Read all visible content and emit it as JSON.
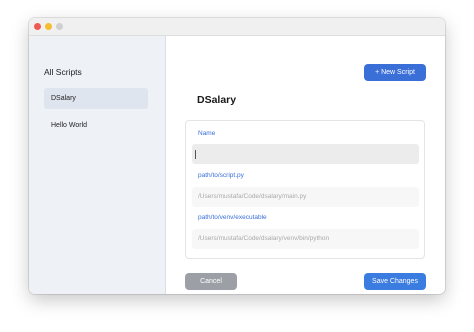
{
  "window": {
    "controls": [
      "close",
      "minimize",
      "maximize"
    ]
  },
  "sidebar": {
    "title": "All Scripts",
    "items": [
      {
        "label": "DSalary",
        "selected": true
      },
      {
        "label": "Hello World",
        "selected": false
      }
    ]
  },
  "header": {
    "new_script_label": "+ New Script"
  },
  "editor": {
    "title": "DSalary",
    "fields": {
      "name": {
        "label": "Name",
        "value": "",
        "placeholder": ""
      },
      "script_path": {
        "label": "path/to/script.py",
        "placeholder": "/Users/mustafa/Code/dsalary/main.py"
      },
      "venv_path": {
        "label": "path/to/venv/executable",
        "placeholder": "/Users/mustafa/Code/dsalary/venv/bin/python"
      }
    }
  },
  "footer": {
    "cancel_label": "Cancel",
    "save_label": "Save Changes"
  },
  "colors": {
    "accent": "#3a6fd8",
    "cancel": "#9ca0a6",
    "sidebar_bg": "#eef1f6",
    "selected_bg": "#dfe5ef"
  }
}
